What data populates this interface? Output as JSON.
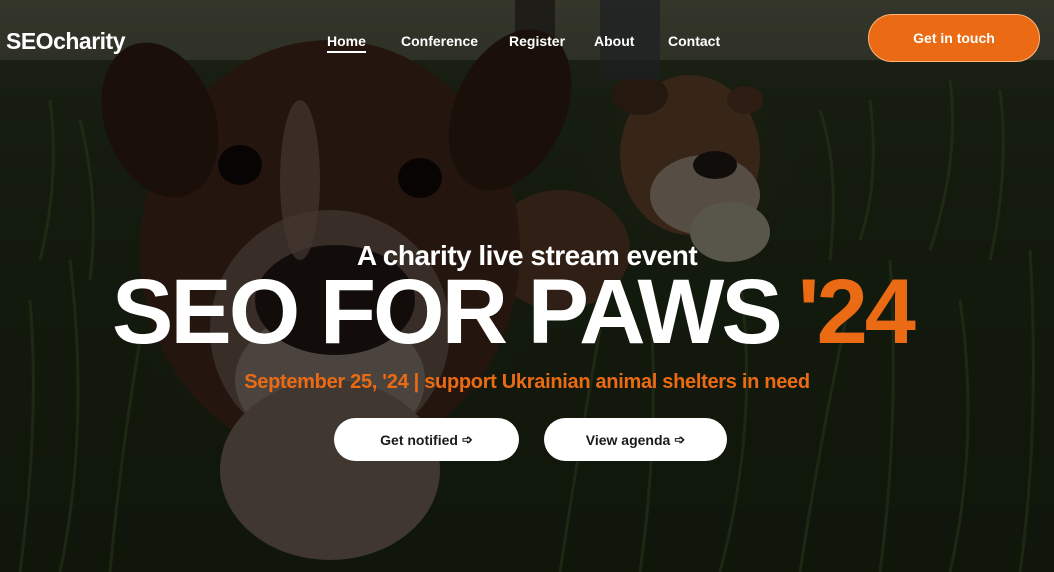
{
  "brand": {
    "logo_text": "SEOcharity"
  },
  "nav": {
    "items": [
      {
        "label": "Home",
        "active": true
      },
      {
        "label": "Conference"
      },
      {
        "label": "Register"
      },
      {
        "label": "About"
      },
      {
        "label": "Contact"
      }
    ]
  },
  "header_cta": {
    "label": "Get in touch"
  },
  "hero": {
    "kicker": "A charity live stream event",
    "title": "SEO FOR PAWS",
    "title_year": "'24",
    "subtitle": "September 25, '24 | support Ukrainian animal shelters in need",
    "buttons": [
      {
        "label": "Get notified",
        "icon": "arrow-right-icon"
      },
      {
        "label": "View agenda",
        "icon": "arrow-right-icon"
      }
    ],
    "background": "two-boxer-dogs-in-grass-photo"
  },
  "colors": {
    "accent": "#ea6b14",
    "text": "#ffffff",
    "button_bg": "#ffffff"
  }
}
